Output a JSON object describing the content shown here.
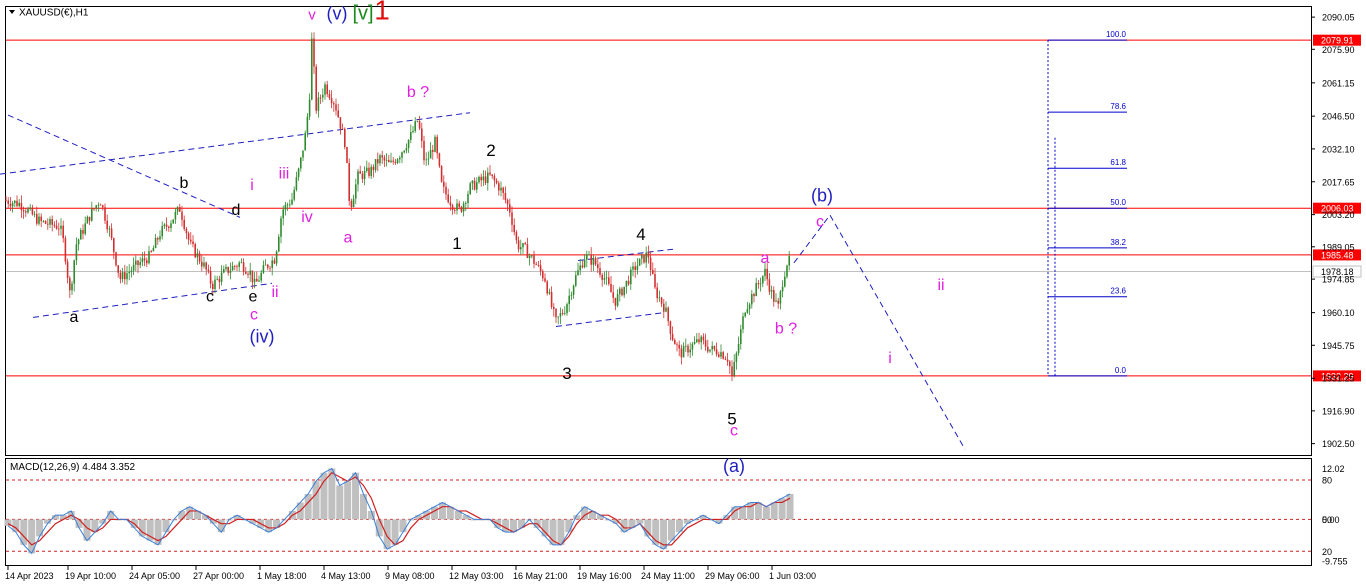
{
  "chart_data": [
    {
      "type": "candlestick",
      "title": "XAUUSD(€),H1",
      "symbol": "XAUUSD(€)",
      "timeframe": "H1",
      "ylim": [
        1897.5,
        2094.5
      ],
      "y_ticks": [
        "2090.05",
        "2075.90",
        "2061.15",
        "2046.50",
        "2032.10",
        "2017.65",
        "2003.20",
        "1989.05",
        "1974.85",
        "1960.10",
        "1945.75",
        "1931.25",
        "1916.90",
        "1902.50"
      ],
      "x_ticks": [
        "14 Apr 2023",
        "19 Apr 10:00",
        "24 Apr 05:00",
        "27 Apr 00:00",
        "1 May 18:00",
        "4 May 13:00",
        "9 May 08:00",
        "12 May 03:00",
        "16 May 21:00",
        "19 May 16:00",
        "24 May 11:00",
        "29 May 06:00",
        "1 Jun 03:00"
      ],
      "candle_colors": {
        "up": "#2e8b2e",
        "down": "#d23030"
      },
      "price_path": [
        [
          0,
          2010
        ],
        [
          20,
          2008
        ],
        [
          40,
          2000
        ],
        [
          60,
          1998
        ],
        [
          64,
          1990
        ],
        [
          70,
          1968
        ],
        [
          76,
          1990
        ],
        [
          90,
          2003
        ],
        [
          100,
          2010
        ],
        [
          110,
          1995
        ],
        [
          120,
          1975
        ],
        [
          140,
          1982
        ],
        [
          150,
          1985
        ],
        [
          160,
          1995
        ],
        [
          170,
          2000
        ],
        [
          180,
          2006
        ],
        [
          190,
          1990
        ],
        [
          205,
          1980
        ],
        [
          212,
          1972
        ],
        [
          225,
          1978
        ],
        [
          240,
          1982
        ],
        [
          250,
          1978
        ],
        [
          255,
          1972
        ],
        [
          265,
          1980
        ],
        [
          275,
          1984
        ],
        [
          282,
          2005
        ],
        [
          292,
          2010
        ],
        [
          300,
          2025
        ],
        [
          306,
          2040
        ],
        [
          310,
          2058
        ],
        [
          312,
          2082
        ],
        [
          316,
          2050
        ],
        [
          325,
          2060
        ],
        [
          335,
          2052
        ],
        [
          345,
          2035
        ],
        [
          350,
          2006
        ],
        [
          358,
          2020
        ],
        [
          370,
          2022
        ],
        [
          380,
          2028
        ],
        [
          390,
          2025
        ],
        [
          400,
          2030
        ],
        [
          410,
          2037
        ],
        [
          418,
          2045
        ],
        [
          425,
          2025
        ],
        [
          435,
          2035
        ],
        [
          442,
          2015
        ],
        [
          452,
          2008
        ],
        [
          460,
          2005
        ],
        [
          470,
          2015
        ],
        [
          480,
          2018
        ],
        [
          490,
          2020
        ],
        [
          500,
          2015
        ],
        [
          510,
          2005
        ],
        [
          517,
          1990
        ],
        [
          525,
          1988
        ],
        [
          535,
          1982
        ],
        [
          545,
          1975
        ],
        [
          552,
          1962
        ],
        [
          556,
          1956
        ],
        [
          565,
          1962
        ],
        [
          575,
          1975
        ],
        [
          585,
          1985
        ],
        [
          595,
          1982
        ],
        [
          605,
          1975
        ],
        [
          615,
          1965
        ],
        [
          625,
          1972
        ],
        [
          635,
          1980
        ],
        [
          648,
          1986
        ],
        [
          655,
          1970
        ],
        [
          665,
          1962
        ],
        [
          672,
          1950
        ],
        [
          680,
          1942
        ],
        [
          690,
          1945
        ],
        [
          700,
          1948
        ],
        [
          710,
          1944
        ],
        [
          720,
          1943
        ],
        [
          728,
          1940
        ],
        [
          732,
          1932
        ],
        [
          738,
          1945
        ],
        [
          745,
          1962
        ],
        [
          755,
          1970
        ],
        [
          765,
          1978
        ],
        [
          772,
          1968
        ],
        [
          778,
          1962
        ],
        [
          783,
          1975
        ],
        [
          788,
          1984
        ],
        [
          792,
          1979
        ]
      ],
      "horizontal_levels": [
        {
          "price": 2079.91,
          "label": "2079.91",
          "color": "#ff0000"
        },
        {
          "price": 2006.03,
          "label": "2006.03",
          "color": "#ff0000"
        },
        {
          "price": 1985.48,
          "label": "1985.48",
          "color": "#ff0000"
        },
        {
          "price": 1932.29,
          "label": "1932.29",
          "color": "#ff0000"
        }
      ],
      "current_price": {
        "price": 1978.18,
        "label": "1978.18"
      },
      "fibonacci": {
        "color": "#0000cc",
        "levels": [
          {
            "ratio": "100.0",
            "price": 2079.91
          },
          {
            "ratio": "78.6",
            "price": 2048.3
          },
          {
            "ratio": "61.8",
            "price": 2023.6
          },
          {
            "ratio": "50.0",
            "price": 2006.03
          },
          {
            "ratio": "38.2",
            "price": 1988.6
          },
          {
            "ratio": "23.6",
            "price": 1967.1
          },
          {
            "ratio": "0.0",
            "price": 1932.29
          }
        ]
      },
      "wave_labels": [
        {
          "text": "v",
          "x": 312,
          "price": 2089,
          "color": "#e020e0",
          "size": 15
        },
        {
          "text": "(v)",
          "x": 337,
          "price": 2089,
          "color": "#1f1fbf",
          "size": 18
        },
        {
          "text": "[v]",
          "x": 363,
          "price": 2089,
          "color": "#1a8a1a",
          "size": 20
        },
        {
          "text": "1",
          "x": 382,
          "price": 2089,
          "color": "#e01010",
          "size": 28
        },
        {
          "text": "b ?",
          "x": 418,
          "price": 2055,
          "color": "#e020e0",
          "size": 16
        },
        {
          "text": "iii",
          "x": 284,
          "price": 2019,
          "color": "#e020e0",
          "size": 16
        },
        {
          "text": "i",
          "x": 252,
          "price": 2014,
          "color": "#e020e0",
          "size": 16
        },
        {
          "text": "iv",
          "x": 307,
          "price": 2000,
          "color": "#e020e0",
          "size": 16
        },
        {
          "text": "a",
          "x": 348,
          "price": 1991,
          "color": "#e020e0",
          "size": 16
        },
        {
          "text": "ii",
          "x": 275,
          "price": 1967,
          "color": "#e020e0",
          "size": 16
        },
        {
          "text": "c",
          "x": 254,
          "price": 1957,
          "color": "#e020e0",
          "size": 16
        },
        {
          "text": "(iv)",
          "x": 262,
          "price": 1947,
          "color": "#1f1fbf",
          "size": 18
        },
        {
          "text": "b",
          "x": 184,
          "price": 2015,
          "color": "#000000",
          "size": 16
        },
        {
          "text": "d",
          "x": 236,
          "price": 2003,
          "color": "#000000",
          "size": 16
        },
        {
          "text": "c",
          "x": 210,
          "price": 1965,
          "color": "#000000",
          "size": 16
        },
        {
          "text": "e",
          "x": 253,
          "price": 1965,
          "color": "#000000",
          "size": 16
        },
        {
          "text": "a",
          "x": 74,
          "price": 1956,
          "color": "#000000",
          "size": 16
        },
        {
          "text": "2",
          "x": 491,
          "price": 2029,
          "color": "#000000",
          "size": 17
        },
        {
          "text": "1",
          "x": 457,
          "price": 1988,
          "color": "#000000",
          "size": 17
        },
        {
          "text": "4",
          "x": 641,
          "price": 1992,
          "color": "#000000",
          "size": 17
        },
        {
          "text": "3",
          "x": 567,
          "price": 1931,
          "color": "#000000",
          "size": 17
        },
        {
          "text": "5",
          "x": 732,
          "price": 1911,
          "color": "#000000",
          "size": 17
        },
        {
          "text": "c",
          "x": 734,
          "price": 1906,
          "color": "#e020e0",
          "size": 16
        },
        {
          "text": "(a)",
          "x": 734,
          "price": 1890,
          "color": "#1f1fbf",
          "size": 18
        },
        {
          "text": "a",
          "x": 765,
          "price": 1982,
          "color": "#e020e0",
          "size": 16
        },
        {
          "text": "b ?",
          "x": 786,
          "price": 1951,
          "color": "#e020e0",
          "size": 16
        },
        {
          "text": "(b)",
          "x": 822,
          "price": 2009,
          "color": "#1f1fbf",
          "size": 18
        },
        {
          "text": "c",
          "x": 820,
          "price": 1998,
          "color": "#e020e0",
          "size": 16
        },
        {
          "text": "ii",
          "x": 941,
          "price": 1970,
          "color": "#e020e0",
          "size": 16
        },
        {
          "text": "i",
          "x": 890,
          "price": 1938,
          "color": "#e020e0",
          "size": 16
        }
      ],
      "trend_lines": [
        {
          "points": [
            [
              8,
              2047
            ],
            [
              240,
              2002
            ]
          ],
          "color": "#1f1fbf",
          "dash": true
        },
        {
          "points": [
            [
              0,
              2021
            ],
            [
              470,
              2048
            ]
          ],
          "color": "#1f1fbf",
          "dash": true
        },
        {
          "points": [
            [
              33,
              1958
            ],
            [
              272,
              1973
            ]
          ],
          "color": "#1f1fbf",
          "dash": true
        },
        {
          "points": [
            [
              578,
              1983
            ],
            [
              673,
              1988
            ]
          ],
          "color": "#1f1fbf",
          "dash": true
        },
        {
          "points": [
            [
              556,
              1954
            ],
            [
              662,
              1960
            ]
          ],
          "color": "#1f1fbf",
          "dash": true
        },
        {
          "points": [
            [
              794,
              1982
            ],
            [
              830,
              2003
            ],
            [
              965,
              1900
            ]
          ],
          "color": "#1f1fbf",
          "dash": true
        }
      ]
    },
    {
      "type": "line",
      "title": "MACD(12,26,9) 4.484 3.352",
      "indicator": "MACD(12,26,9)",
      "values": [
        "4.484",
        "3.352"
      ],
      "ylim": [
        -10.5,
        14
      ],
      "y_ticks": [
        "12.02",
        "0.00",
        "-9.755"
      ],
      "levels": [
        "80",
        "50",
        "20"
      ],
      "series": [
        {
          "name": "MACD",
          "values": [
            -1.5,
            -3,
            -6,
            -8,
            -4,
            -1,
            1,
            1,
            2,
            -2,
            -5,
            -3,
            -1,
            2,
            0,
            0,
            -2,
            -4,
            -5,
            -6,
            -3,
            0,
            2,
            3,
            2,
            1,
            -1,
            -3,
            0,
            1,
            0,
            -1,
            -2,
            -3,
            -2,
            0,
            2,
            4,
            6,
            9,
            11,
            12,
            8,
            9,
            11,
            6,
            2,
            -4,
            -7,
            -6,
            -3,
            0,
            1,
            2,
            3,
            4,
            3,
            2,
            1,
            0,
            0,
            0,
            -2,
            -3,
            -3,
            -2,
            0,
            -2,
            -4,
            -6,
            -6,
            -3,
            1,
            3,
            2,
            1,
            0,
            -1,
            -3,
            -2,
            -1,
            -4,
            -6,
            -7,
            -5,
            -3,
            -1,
            0,
            1,
            0,
            -1,
            1,
            3,
            3,
            4,
            4,
            3,
            4,
            5,
            6
          ]
        },
        {
          "name": "Signal",
          "values": [
            -1,
            -2,
            -4,
            -6,
            -5,
            -3,
            -1,
            0,
            1,
            0,
            -2,
            -3,
            -2,
            0,
            0,
            0,
            -1,
            -3,
            -4,
            -5,
            -4,
            -2,
            0,
            2,
            2,
            1,
            0,
            -1,
            -1,
            0,
            0,
            0,
            -1,
            -2,
            -2,
            -1,
            1,
            2,
            4,
            6,
            9,
            11,
            10,
            9,
            10,
            8,
            5,
            0,
            -4,
            -6,
            -5,
            -2,
            0,
            1,
            2,
            3,
            3,
            2,
            2,
            1,
            0,
            0,
            -1,
            -2,
            -3,
            -2,
            -1,
            -1,
            -3,
            -5,
            -6,
            -4,
            -1,
            1,
            2,
            1,
            1,
            0,
            -2,
            -2,
            -1,
            -3,
            -5,
            -6,
            -6,
            -4,
            -2,
            -1,
            0,
            0,
            0,
            0,
            2,
            3,
            3,
            4,
            3,
            4,
            4,
            5
          ]
        }
      ]
    }
  ]
}
